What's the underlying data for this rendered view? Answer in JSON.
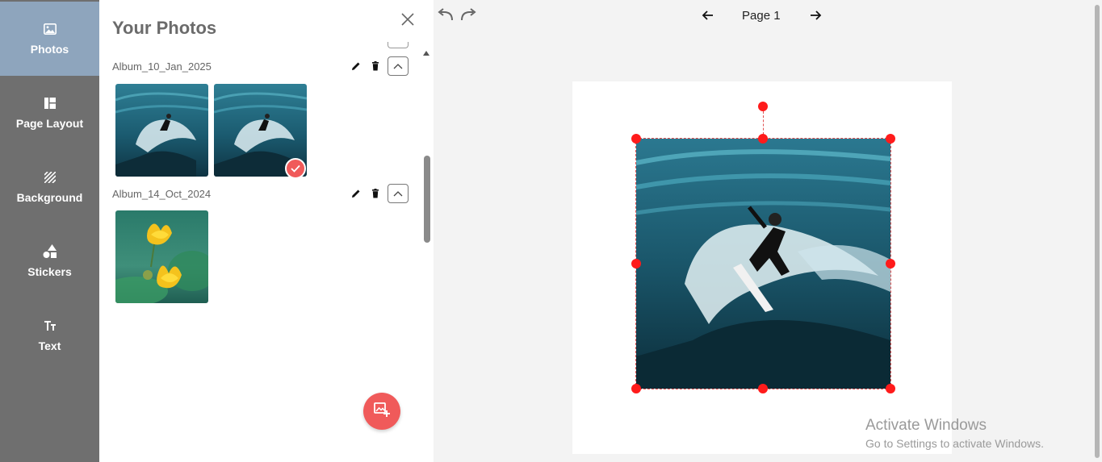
{
  "sidebar": {
    "items": [
      {
        "label": "Photos",
        "icon": "image-icon",
        "active": true
      },
      {
        "label": "Page Layout",
        "icon": "layout-icon",
        "active": false
      },
      {
        "label": "Background",
        "icon": "background-pattern-icon",
        "active": false
      },
      {
        "label": "Stickers",
        "icon": "shapes-icon",
        "active": false
      },
      {
        "label": "Text",
        "icon": "text-size-icon",
        "active": false
      }
    ]
  },
  "panel": {
    "title": "Your Photos",
    "albums": [
      {
        "name": "Album_10_Jan_2025",
        "photos": [
          "surfer-photo",
          "surfer-photo"
        ],
        "selected_index": 1
      },
      {
        "name": "Album_14_Oct_2024",
        "photos": [
          "yellow-lotus-photo"
        ]
      }
    ]
  },
  "editor": {
    "page_label": "Page 1",
    "selected_photo": "surfer-photo"
  },
  "watermark": {
    "title": "Activate Windows",
    "subtitle": "Go to Settings to activate Windows."
  },
  "colors": {
    "sidebar_bg": "#6f6f6f",
    "sidebar_active": "#8ea5bd",
    "accent": "#f05a5a",
    "handle": "#ff1b1b"
  }
}
